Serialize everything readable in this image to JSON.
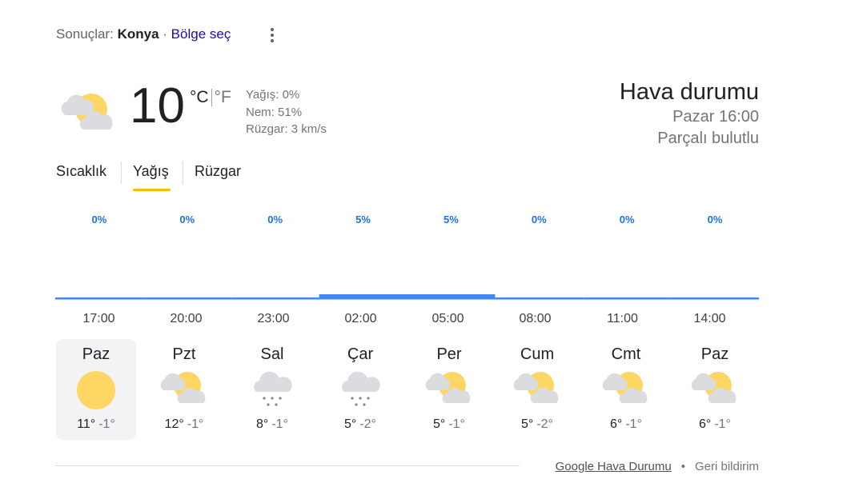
{
  "header": {
    "results_label": "Sonuçlar:",
    "location": "Konya",
    "separator": "·",
    "choose_region": "Bölge seç"
  },
  "current": {
    "icon": "partly-cloudy-icon",
    "temperature": "10",
    "unit_c": "°C",
    "unit_f": "°F",
    "precipitation": "Yağış: 0%",
    "humidity": "Nem: 51%",
    "wind": "Rüzgar: 3 km/s"
  },
  "summary": {
    "title": "Hava durumu",
    "time": "Pazar 16:00",
    "condition": "Parçalı bulutlu"
  },
  "tabs": [
    {
      "label": "Sıcaklık",
      "active": false
    },
    {
      "label": "Yağış",
      "active": true
    },
    {
      "label": "Rüzgar",
      "active": false
    }
  ],
  "chart_data": {
    "type": "bar",
    "categories": [
      "17:00",
      "20:00",
      "23:00",
      "02:00",
      "05:00",
      "08:00",
      "11:00",
      "14:00"
    ],
    "values": [
      0,
      0,
      0,
      5,
      5,
      0,
      0,
      0
    ],
    "value_labels": [
      "0%",
      "0%",
      "0%",
      "5%",
      "5%",
      "0%",
      "0%",
      "0%"
    ],
    "ylim": [
      0,
      100
    ],
    "color": "#4285f4",
    "label_color": "#1a73e8"
  },
  "forecast": [
    {
      "day": "Paz",
      "icon": "sunny-icon",
      "high": "11°",
      "low": "-1°",
      "selected": true
    },
    {
      "day": "Pzt",
      "icon": "partly-cloudy-icon",
      "high": "12°",
      "low": "-1°",
      "selected": false
    },
    {
      "day": "Sal",
      "icon": "snow-icon",
      "high": "8°",
      "low": "-1°",
      "selected": false
    },
    {
      "day": "Çar",
      "icon": "snow-icon",
      "high": "5°",
      "low": "-2°",
      "selected": false
    },
    {
      "day": "Per",
      "icon": "partly-cloudy-icon",
      "high": "5°",
      "low": "-1°",
      "selected": false
    },
    {
      "day": "Cum",
      "icon": "partly-cloudy-icon",
      "high": "5°",
      "low": "-2°",
      "selected": false
    },
    {
      "day": "Cmt",
      "icon": "partly-cloudy-icon",
      "high": "6°",
      "low": "-1°",
      "selected": false
    },
    {
      "day": "Paz",
      "icon": "partly-cloudy-icon",
      "high": "6°",
      "low": "-1°",
      "selected": false
    }
  ],
  "footer": {
    "source": "Google Hava Durumu",
    "dot": "•",
    "feedback": "Geri bildirim"
  }
}
